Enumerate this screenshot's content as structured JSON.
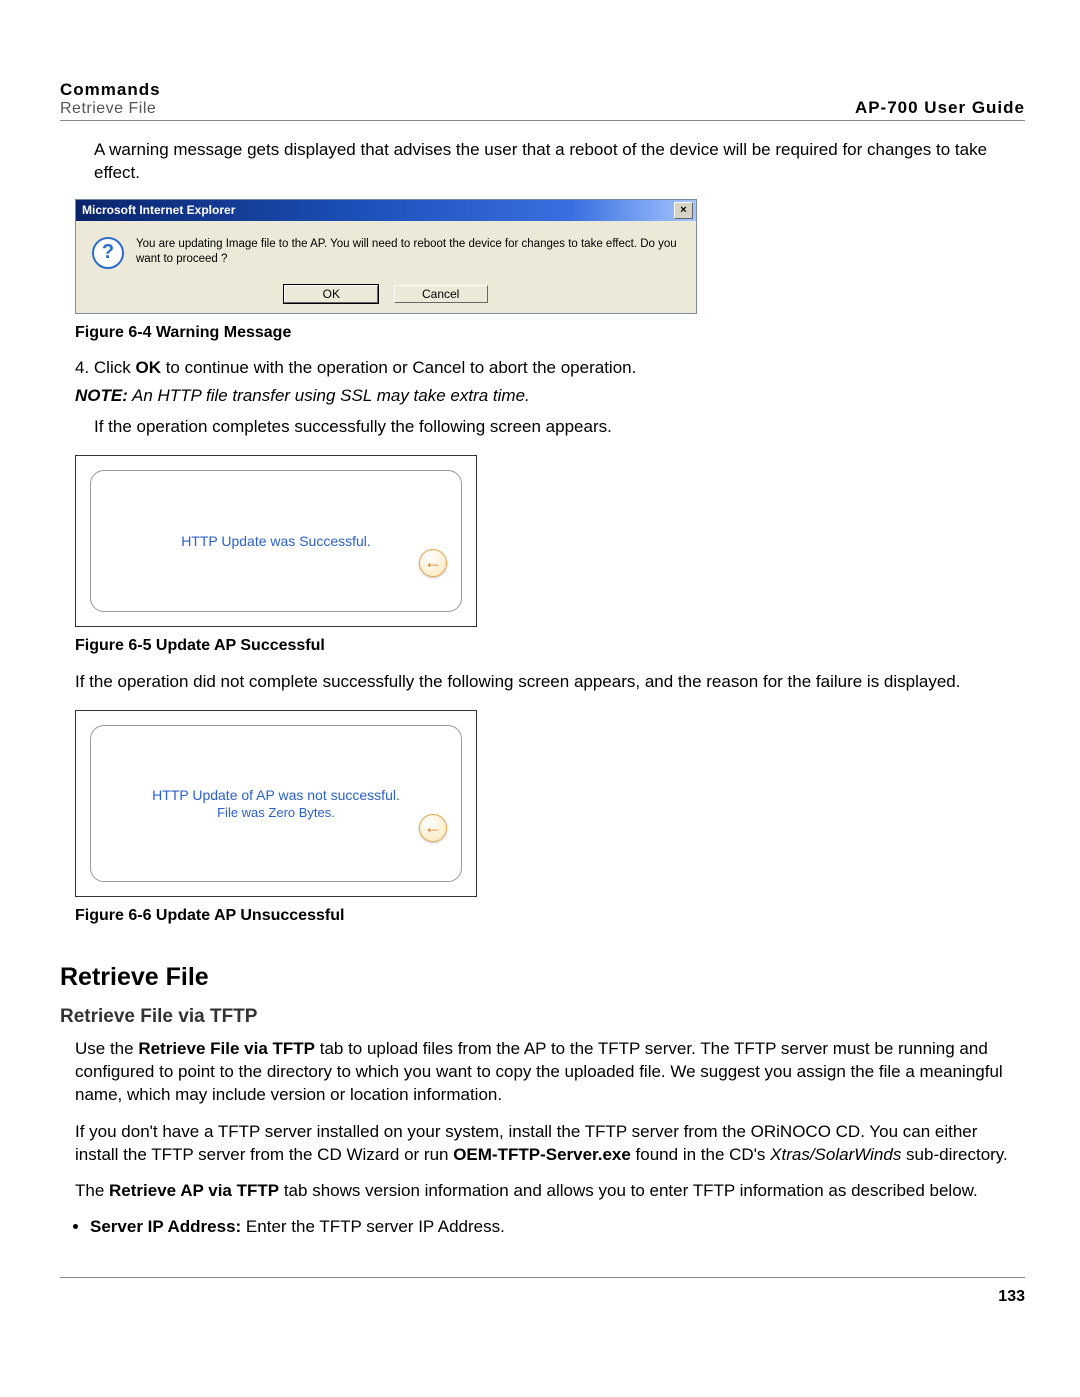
{
  "header": {
    "left_bold": "Commands",
    "left_sub": "Retrieve File",
    "right": "AP-700 User Guide"
  },
  "intro_para": "A warning message gets displayed that advises the user that a reboot of the device will be required for changes to take effect.",
  "ie_dialog": {
    "title": "Microsoft Internet Explorer",
    "close": "×",
    "icon_glyph": "?",
    "message": "You are updating Image file to the AP. You will need to reboot the device for changes to take effect. Do you want to proceed ?",
    "ok": "OK",
    "cancel": "Cancel"
  },
  "fig64": "Figure 6-4 Warning Message",
  "step4_pre": "4.  Click ",
  "step4_bold": "OK",
  "step4_post": " to continue with the operation or Cancel to abort the operation.",
  "note_label": "NOTE:",
  "note_text": " An HTTP file transfer using SSL may take extra time.",
  "after_success": "If the operation completes successfully the following screen appears.",
  "box_success": {
    "line1": "HTTP Update was Successful.",
    "arrow": "←"
  },
  "fig65": "Figure 6-5 Update AP Successful",
  "after_fail": "If the operation did not complete successfully the following screen appears, and the reason for the failure is displayed.",
  "box_fail": {
    "line1": "HTTP Update of AP was not successful.",
    "line2": "File was Zero Bytes.",
    "arrow": "←"
  },
  "fig66": "Figure 6-6 Update AP Unsuccessful",
  "h2": "Retrieve File",
  "h3": "Retrieve File via TFTP",
  "p1_pre": "Use the ",
  "p1_bold": "Retrieve File via TFTP",
  "p1_post": " tab to upload files from the AP to the TFTP server. The TFTP server must be running and configured to point to the directory to which you want to copy the uploaded file. We suggest you assign the file a meaningful name, which may include version or location information.",
  "p2_pre": "If you don't have a TFTP server installed on your system, install the TFTP server from the ORiNOCO CD. You can either install the TFTP server from the CD Wizard or run ",
  "p2_bold": "OEM-TFTP-Server.exe",
  "p2_mid": " found in the CD's ",
  "p2_ital": "Xtras/SolarWinds",
  "p2_post": " sub-directory.",
  "p3_pre": "The ",
  "p3_bold": "Retrieve AP via TFTP",
  "p3_post": " tab shows version information and allows you to enter TFTP information as described below.",
  "bullet1_bold": "Server IP Address:",
  "bullet1_post": " Enter the TFTP server IP Address.",
  "page_no": "133"
}
